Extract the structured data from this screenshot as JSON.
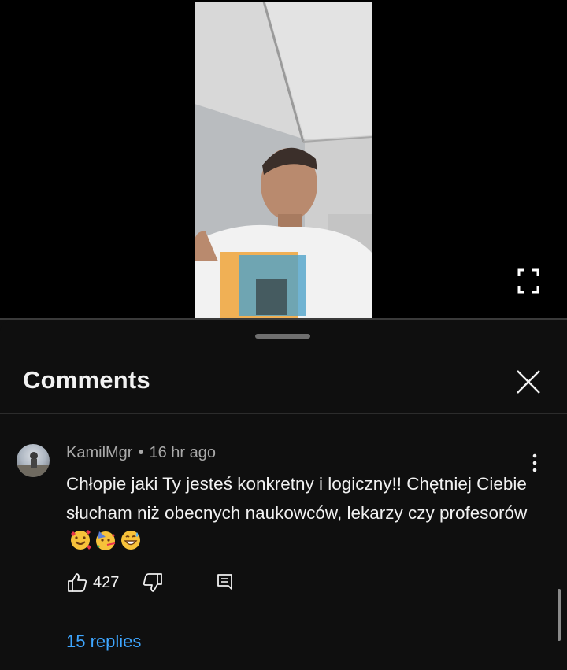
{
  "sheet": {
    "title": "Comments"
  },
  "comment": {
    "author": "KamilMgr",
    "separator": "•",
    "time": "16 hr ago",
    "text": "Chłopie jaki Ty jesteś konkretny i logiczny!! Chętniej Ciebie słucham niż obecnych naukowców, lekarzy czy profesorów",
    "emojis": [
      "smiling-face-with-hearts",
      "partying-face",
      "grinning-face-with-sweat"
    ],
    "like_count": "427",
    "replies_label": "15 replies"
  },
  "colors": {
    "background": "#0f0f0f",
    "text": "#f1f1f1",
    "secondary_text": "#aaaaaa",
    "link": "#3ea6ff"
  },
  "icons": {
    "fullscreen": "fullscreen-icon",
    "close": "close-icon",
    "more": "more-vert-icon",
    "like": "thumb-up-icon",
    "dislike": "thumb-down-icon",
    "reply": "reply-comment-icon"
  }
}
